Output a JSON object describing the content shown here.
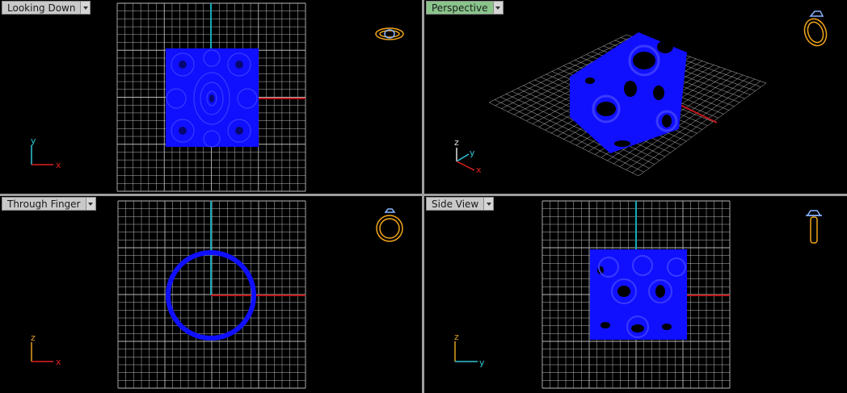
{
  "viewports": {
    "top_left": {
      "label": "Looking Down",
      "axis_labels": {
        "vertical": "y",
        "horizontal": "x"
      }
    },
    "top_right": {
      "label": "Perspective",
      "axis_labels": {
        "vertical": "z",
        "horizontal": "x",
        "depth": "y"
      }
    },
    "bottom_left": {
      "label": "Through Finger",
      "axis_labels": {
        "vertical": "z",
        "horizontal": "x"
      }
    },
    "bottom_right": {
      "label": "Side View",
      "axis_labels": {
        "vertical": "z",
        "horizontal": "y"
      }
    }
  },
  "colors": {
    "grid": "#b8b8b8",
    "model": "#1010ff",
    "axis_y": "#17a9b6",
    "axis_x": "#c0171b",
    "gizmo_y": "#2ec6d6",
    "gizmo_x": "#e02020",
    "gizmo_z": "#e0a020",
    "ring_icon": "#f2a51a",
    "active_tab": "#89c48a"
  },
  "icons": {
    "top_left": "ring-top-view-icon",
    "top_right": "ring-perspective-icon",
    "bottom_left": "ring-front-view-icon",
    "bottom_right": "ring-side-view-icon"
  }
}
